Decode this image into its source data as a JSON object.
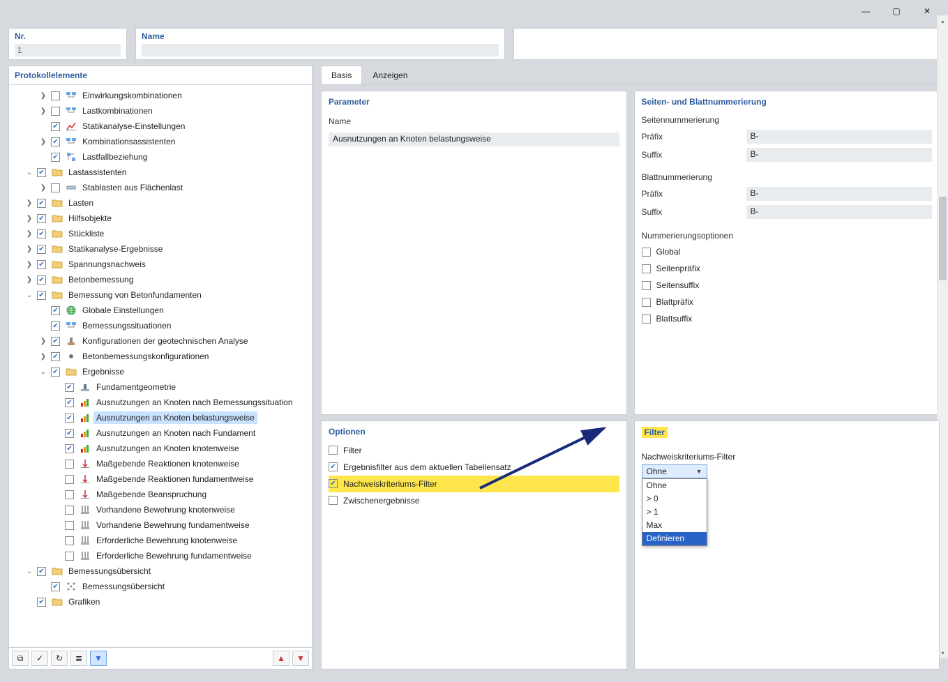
{
  "window": {
    "minimize": "—",
    "maximize": "▢",
    "close": "✕"
  },
  "header": {
    "nr_label": "Nr.",
    "nr_value": "1",
    "name_label": "Name",
    "name_value": ""
  },
  "tree": {
    "title": "Protokollelemente",
    "items": [
      {
        "d": 2,
        "e": ">",
        "c": false,
        "ico": "kombi",
        "t": "Einwirkungskombinationen"
      },
      {
        "d": 2,
        "e": ">",
        "c": false,
        "ico": "kombi",
        "t": "Lastkombinationen"
      },
      {
        "d": 2,
        "e": "",
        "c": true,
        "ico": "statik",
        "t": "Statikanalyse-Einstellungen"
      },
      {
        "d": 2,
        "e": ">",
        "c": true,
        "ico": "kombi",
        "t": "Kombinationsassistenten"
      },
      {
        "d": 2,
        "e": "",
        "c": true,
        "ico": "lastfall",
        "t": "Lastfallbeziehung"
      },
      {
        "d": 1,
        "e": "v",
        "c": true,
        "ico": "fold",
        "t": "Lastassistenten"
      },
      {
        "d": 2,
        "e": ">",
        "c": false,
        "ico": "stab",
        "t": "Stablasten aus Flächenlast"
      },
      {
        "d": 1,
        "e": ">",
        "c": true,
        "ico": "fold",
        "t": "Lasten"
      },
      {
        "d": 1,
        "e": ">",
        "c": true,
        "ico": "fold",
        "t": "Hilfsobjekte"
      },
      {
        "d": 1,
        "e": ">",
        "c": true,
        "ico": "fold",
        "t": "Stückliste"
      },
      {
        "d": 1,
        "e": ">",
        "c": true,
        "ico": "fold",
        "t": "Statikanalyse-Ergebnisse"
      },
      {
        "d": 1,
        "e": ">",
        "c": true,
        "ico": "fold",
        "t": "Spannungsnachweis"
      },
      {
        "d": 1,
        "e": ">",
        "c": true,
        "ico": "fold",
        "t": "Betonbemessung"
      },
      {
        "d": 1,
        "e": "v",
        "c": true,
        "ico": "fold",
        "t": "Bemessung von Betonfundamenten"
      },
      {
        "d": 2,
        "e": "",
        "c": true,
        "ico": "globe",
        "t": "Globale Einstellungen"
      },
      {
        "d": 2,
        "e": "",
        "c": true,
        "ico": "kombi",
        "t": "Bemessungssituationen"
      },
      {
        "d": 2,
        "e": ">",
        "c": true,
        "ico": "geo",
        "t": "Konfigurationen der geotechnischen Analyse"
      },
      {
        "d": 2,
        "e": ">",
        "c": true,
        "ico": "dot",
        "t": "Betonbemessungskonfigurationen"
      },
      {
        "d": 2,
        "e": "v",
        "c": true,
        "ico": "fold",
        "t": "Ergebnisse"
      },
      {
        "d": 3,
        "e": "",
        "c": true,
        "ico": "fund",
        "t": "Fundamentgeometrie"
      },
      {
        "d": 3,
        "e": "",
        "c": true,
        "ico": "ausn",
        "t": "Ausnutzungen an Knoten nach Bemessungssituation"
      },
      {
        "d": 3,
        "e": "",
        "c": true,
        "ico": "ausn",
        "t": "Ausnutzungen an Knoten belastungsweise",
        "sel": true
      },
      {
        "d": 3,
        "e": "",
        "c": true,
        "ico": "ausn",
        "t": "Ausnutzungen an Knoten nach Fundament"
      },
      {
        "d": 3,
        "e": "",
        "c": true,
        "ico": "ausn",
        "t": "Ausnutzungen an Knoten knotenweise"
      },
      {
        "d": 3,
        "e": "",
        "c": false,
        "ico": "reak",
        "t": "Maßgebende Reaktionen knotenweise"
      },
      {
        "d": 3,
        "e": "",
        "c": false,
        "ico": "reak",
        "t": "Maßgebende Reaktionen fundamentweise"
      },
      {
        "d": 3,
        "e": "",
        "c": false,
        "ico": "reak",
        "t": "Maßgebende Beanspruchung"
      },
      {
        "d": 3,
        "e": "",
        "c": false,
        "ico": "bew",
        "t": "Vorhandene Bewehrung knotenweise"
      },
      {
        "d": 3,
        "e": "",
        "c": false,
        "ico": "bew",
        "t": "Vorhandene Bewehrung fundamentweise"
      },
      {
        "d": 3,
        "e": "",
        "c": false,
        "ico": "bew",
        "t": "Erforderliche Bewehrung knotenweise"
      },
      {
        "d": 3,
        "e": "",
        "c": false,
        "ico": "bew",
        "t": "Erforderliche Bewehrung fundamentweise"
      },
      {
        "d": 1,
        "e": "v",
        "c": true,
        "ico": "fold",
        "t": "Bemessungsübersicht"
      },
      {
        "d": 2,
        "e": "",
        "c": true,
        "ico": "uebers",
        "t": "Bemessungsübersicht"
      },
      {
        "d": 1,
        "e": "",
        "c": true,
        "ico": "fold",
        "t": "Grafiken"
      }
    ],
    "tb": {
      "b1": "⧉",
      "b2": "✓",
      "b3": "↻",
      "b4": "≣",
      "b5": "▼",
      "up": "▲",
      "dn": "▼"
    }
  },
  "tabs": {
    "basis": "Basis",
    "anzeigen": "Anzeigen"
  },
  "param": {
    "title": "Parameter",
    "name_label": "Name",
    "name_value": "Ausnutzungen an Knoten belastungsweise"
  },
  "numbering": {
    "title": "Seiten- und Blattnummerierung",
    "page_title": "Seitennummerierung",
    "sheet_title": "Blattnummerierung",
    "prefix": "Präfix",
    "suffix": "Suffix",
    "bval": "B-",
    "opts_title": "Nummerierungsoptionen",
    "opts": [
      "Global",
      "Seitenpräfix",
      "Seitensuffix",
      "Blattpräfix",
      "Blattsuffix"
    ]
  },
  "options": {
    "title": "Optionen",
    "items": [
      {
        "c": false,
        "t": "Filter"
      },
      {
        "c": true,
        "t": "Ergebnisfilter aus dem aktuellen Tabellensatz"
      },
      {
        "c": true,
        "t": "Nachweiskriteriums-Filter",
        "hl": true
      },
      {
        "c": false,
        "t": "Zwischenergebnisse"
      }
    ]
  },
  "filter": {
    "title": "Filter",
    "label": "Nachweiskriteriums-Filter",
    "value": "Ohne",
    "options": [
      "Ohne",
      "> 0",
      "> 1",
      "Max",
      "Definieren"
    ]
  }
}
